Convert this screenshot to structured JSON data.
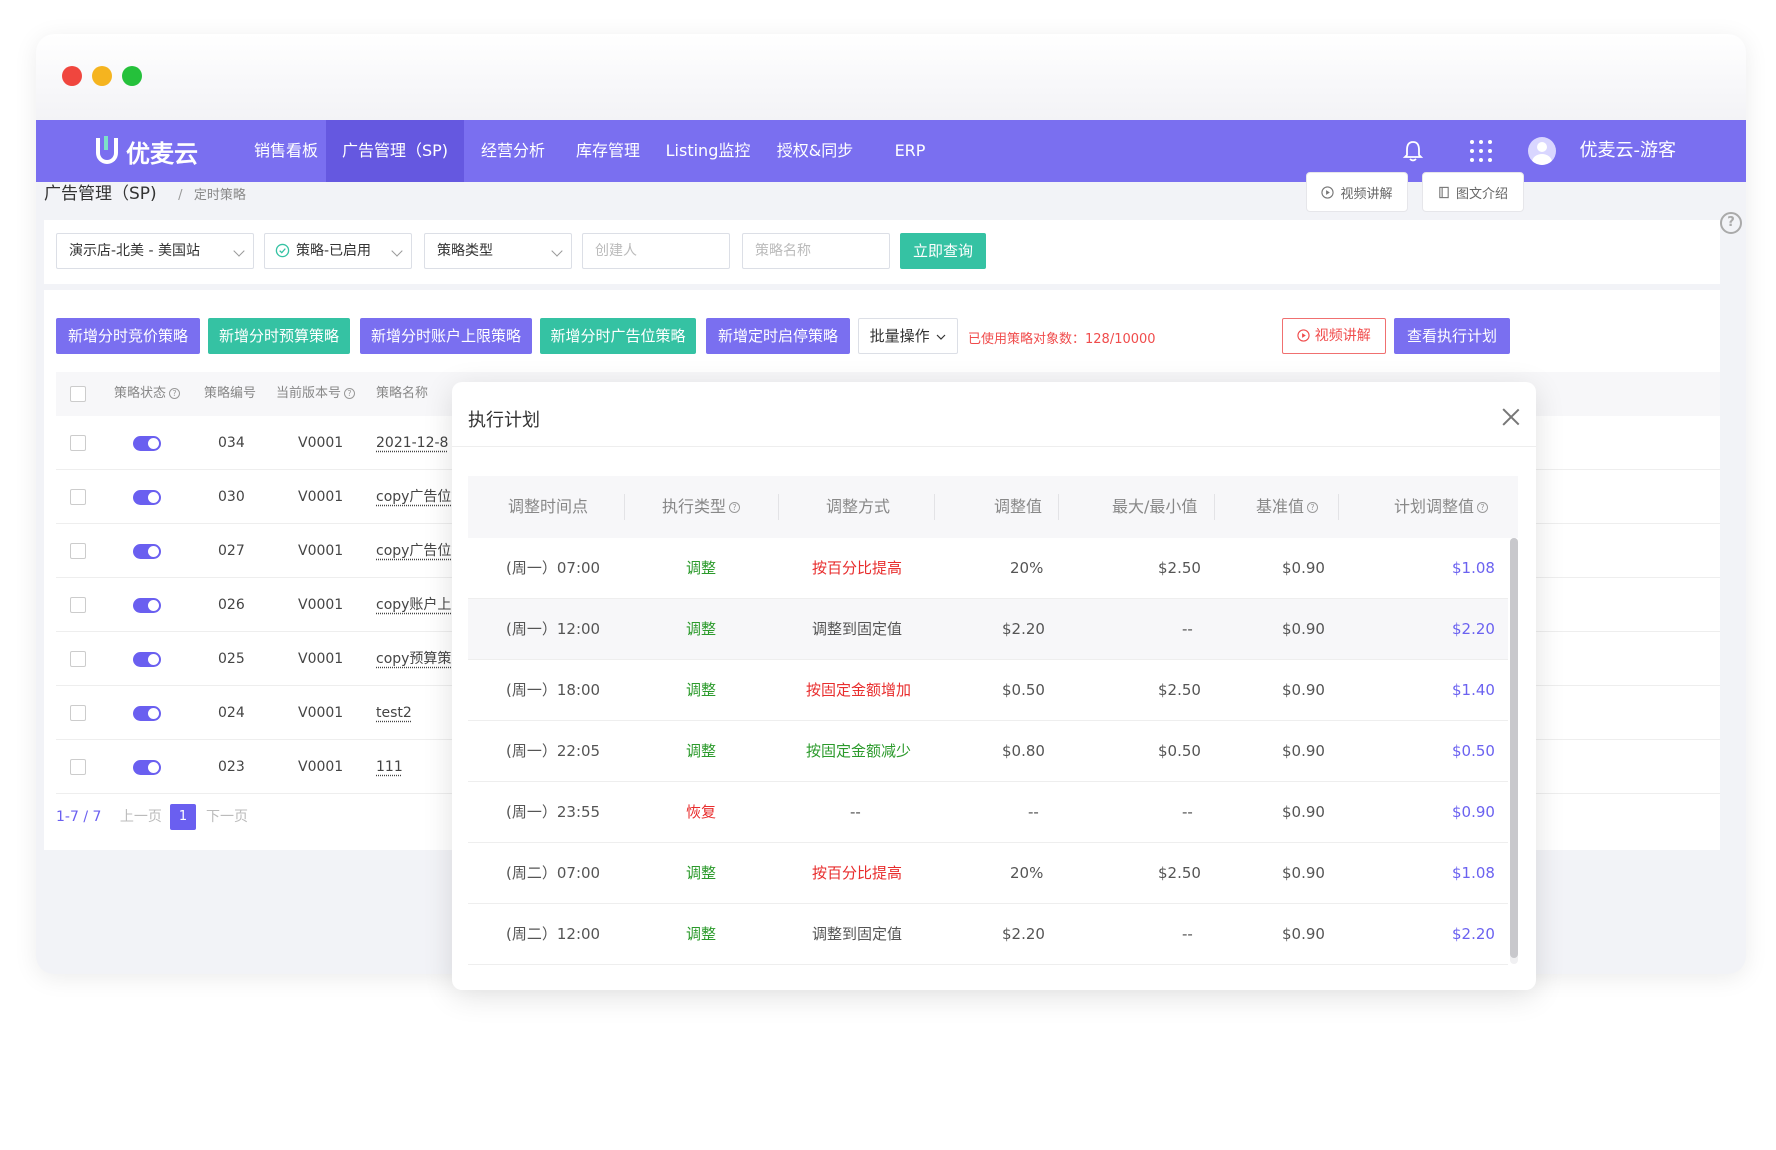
{
  "app": {
    "name": "优麦云",
    "user": "优麦云-游客"
  },
  "nav": [
    "销售看板",
    "广告管理（SP)",
    "经营分析",
    "库存管理",
    "Listing监控",
    "授权&同步",
    "ERP"
  ],
  "breadcrumb": {
    "title": "广告管理（SP)",
    "sep": "/",
    "sub": "定时策略"
  },
  "top_buttons": {
    "video": "视频讲解",
    "doc": "图文介绍"
  },
  "filters": {
    "store": "演示店-北美 - 美国站",
    "status": "策略-已启用",
    "type": "策略类型",
    "creator_placeholder": "创建人",
    "name_placeholder": "策略名称",
    "query": "立即查询"
  },
  "actions": {
    "b1": "新增分时竞价策略",
    "b2": "新增分时预算策略",
    "b3": "新增分时账户上限策略",
    "b4": "新增分时广告位策略",
    "b5": "新增定时启停策略",
    "batch": "批量操作",
    "usage": "已使用策略对象数：128/10000",
    "video": "视频讲解",
    "plan": "查看执行计划"
  },
  "table": {
    "headers": {
      "status": "策略状态",
      "id": "策略编号",
      "version": "当前版本号",
      "name": "策略名称"
    },
    "rows": [
      {
        "id": "034",
        "version": "V0001",
        "name": "2021-12-8"
      },
      {
        "id": "030",
        "version": "V0001",
        "name": "copy广告位策"
      },
      {
        "id": "027",
        "version": "V0001",
        "name": "copy广告位策"
      },
      {
        "id": "026",
        "version": "V0001",
        "name": "copy账户上限"
      },
      {
        "id": "025",
        "version": "V0001",
        "name": "copy预算策略"
      },
      {
        "id": "024",
        "version": "V0001",
        "name": "test2"
      },
      {
        "id": "023",
        "version": "V0001",
        "name": "111"
      }
    ]
  },
  "pager": {
    "range": "1-7 / 7",
    "prev": "上一页",
    "current": "1",
    "next": "下一页"
  },
  "modal": {
    "title": "执行计划",
    "headers": {
      "time": "调整时间点",
      "type": "执行类型",
      "method": "调整方式",
      "value": "调整值",
      "maxmin": "最大/最小值",
      "base": "基准值",
      "planned": "计划调整值"
    },
    "rows": [
      {
        "time": "(周一）07:00",
        "type": "调整",
        "method": "按百分比提高",
        "value": "20%",
        "maxmin": "$2.50",
        "base": "$0.90",
        "planned": "$1.08",
        "method_color": "red",
        "type_color": "green"
      },
      {
        "time": "(周一）12:00",
        "type": "调整",
        "method": "调整到固定值",
        "value": "$2.20",
        "maxmin": "--",
        "base": "$0.90",
        "planned": "$2.20",
        "method_color": "gray",
        "type_color": "green"
      },
      {
        "time": "(周一）18:00",
        "type": "调整",
        "method": "按固定金额增加",
        "value": "$0.50",
        "maxmin": "$2.50",
        "base": "$0.90",
        "planned": "$1.40",
        "method_color": "red",
        "type_color": "green"
      },
      {
        "time": "(周一）22:05",
        "type": "调整",
        "method": "按固定金额减少",
        "value": "$0.80",
        "maxmin": "$0.50",
        "base": "$0.90",
        "planned": "$0.50",
        "method_color": "green",
        "type_color": "green"
      },
      {
        "time": "(周一）23:55",
        "type": "恢复",
        "method": "--",
        "value": "--",
        "maxmin": "--",
        "base": "$0.90",
        "planned": "$0.90",
        "method_color": "gray",
        "type_color": "red"
      },
      {
        "time": "(周二）07:00",
        "type": "调整",
        "method": "按百分比提高",
        "value": "20%",
        "maxmin": "$2.50",
        "base": "$0.90",
        "planned": "$1.08",
        "method_color": "red",
        "type_color": "green"
      },
      {
        "time": "(周二）12:00",
        "type": "调整",
        "method": "调整到固定值",
        "value": "$2.20",
        "maxmin": "--",
        "base": "$0.90",
        "planned": "$2.20",
        "method_color": "gray",
        "type_color": "green"
      }
    ]
  },
  "colors": {
    "brand": "#7a6ff0",
    "green": "#35c2a3",
    "danger": "#e82d2d",
    "link": "#6b62f0"
  }
}
